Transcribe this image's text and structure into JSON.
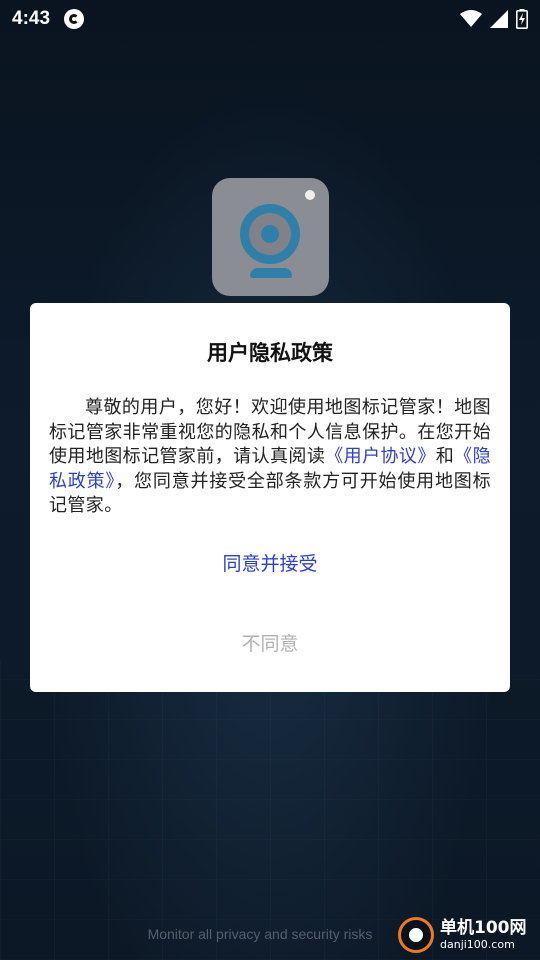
{
  "status_bar": {
    "time": "4:43",
    "app_icon": "sync-app-icon",
    "icons": [
      "wifi-icon",
      "cell-signal-icon",
      "battery-charging-icon"
    ]
  },
  "app": {
    "icon": "webcam-icon"
  },
  "dialog": {
    "title": "用户隐私政策",
    "body_before": "尊敬的用户，您好！欢迎使用地图标记管家！地图标记管家非常重视您的隐私和个人信息保护。在您开始使用地图标记管家前，请认真阅读",
    "user_agreement_link": "《用户协议》",
    "and_text": "和",
    "privacy_policy_link": "《隐私政策》",
    "body_after": "，您同意并接受全部条款方可开始使用地图标记管家。",
    "accept_label": "同意并接受",
    "decline_label": "不同意",
    "link_color": "#2e3fcf",
    "decline_color": "#b3b3b3"
  },
  "footer": {
    "text": "Monitor all privacy and security risks"
  },
  "watermark": {
    "main": "单机100网",
    "sub": "danji100.com"
  }
}
